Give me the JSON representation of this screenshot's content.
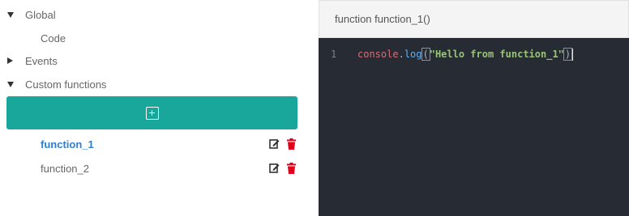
{
  "tree": {
    "global": {
      "label": "Global",
      "expanded": true
    },
    "code": {
      "label": "Code"
    },
    "events": {
      "label": "Events",
      "expanded": false
    },
    "custom_functions": {
      "label": "Custom functions",
      "expanded": true
    },
    "add_button": {
      "icon": "plus-square-icon",
      "color": "#1aa79b"
    },
    "functions": [
      {
        "label": "function_1",
        "selected": true,
        "color": "#2d7fd3"
      },
      {
        "label": "function_2",
        "selected": false,
        "color": "#666666"
      }
    ],
    "action_icons": {
      "edit": "edit-icon",
      "delete": "trash-icon",
      "delete_color": "#e0001b"
    }
  },
  "editor": {
    "title": "function function_1()",
    "lines": [
      {
        "number": "1",
        "tokens": {
          "object": "console",
          "dot": ".",
          "method": "log",
          "open_paren": "(",
          "string": "\"Hello from function_1\"",
          "close_paren": ")"
        }
      }
    ],
    "background": "#272b33"
  }
}
